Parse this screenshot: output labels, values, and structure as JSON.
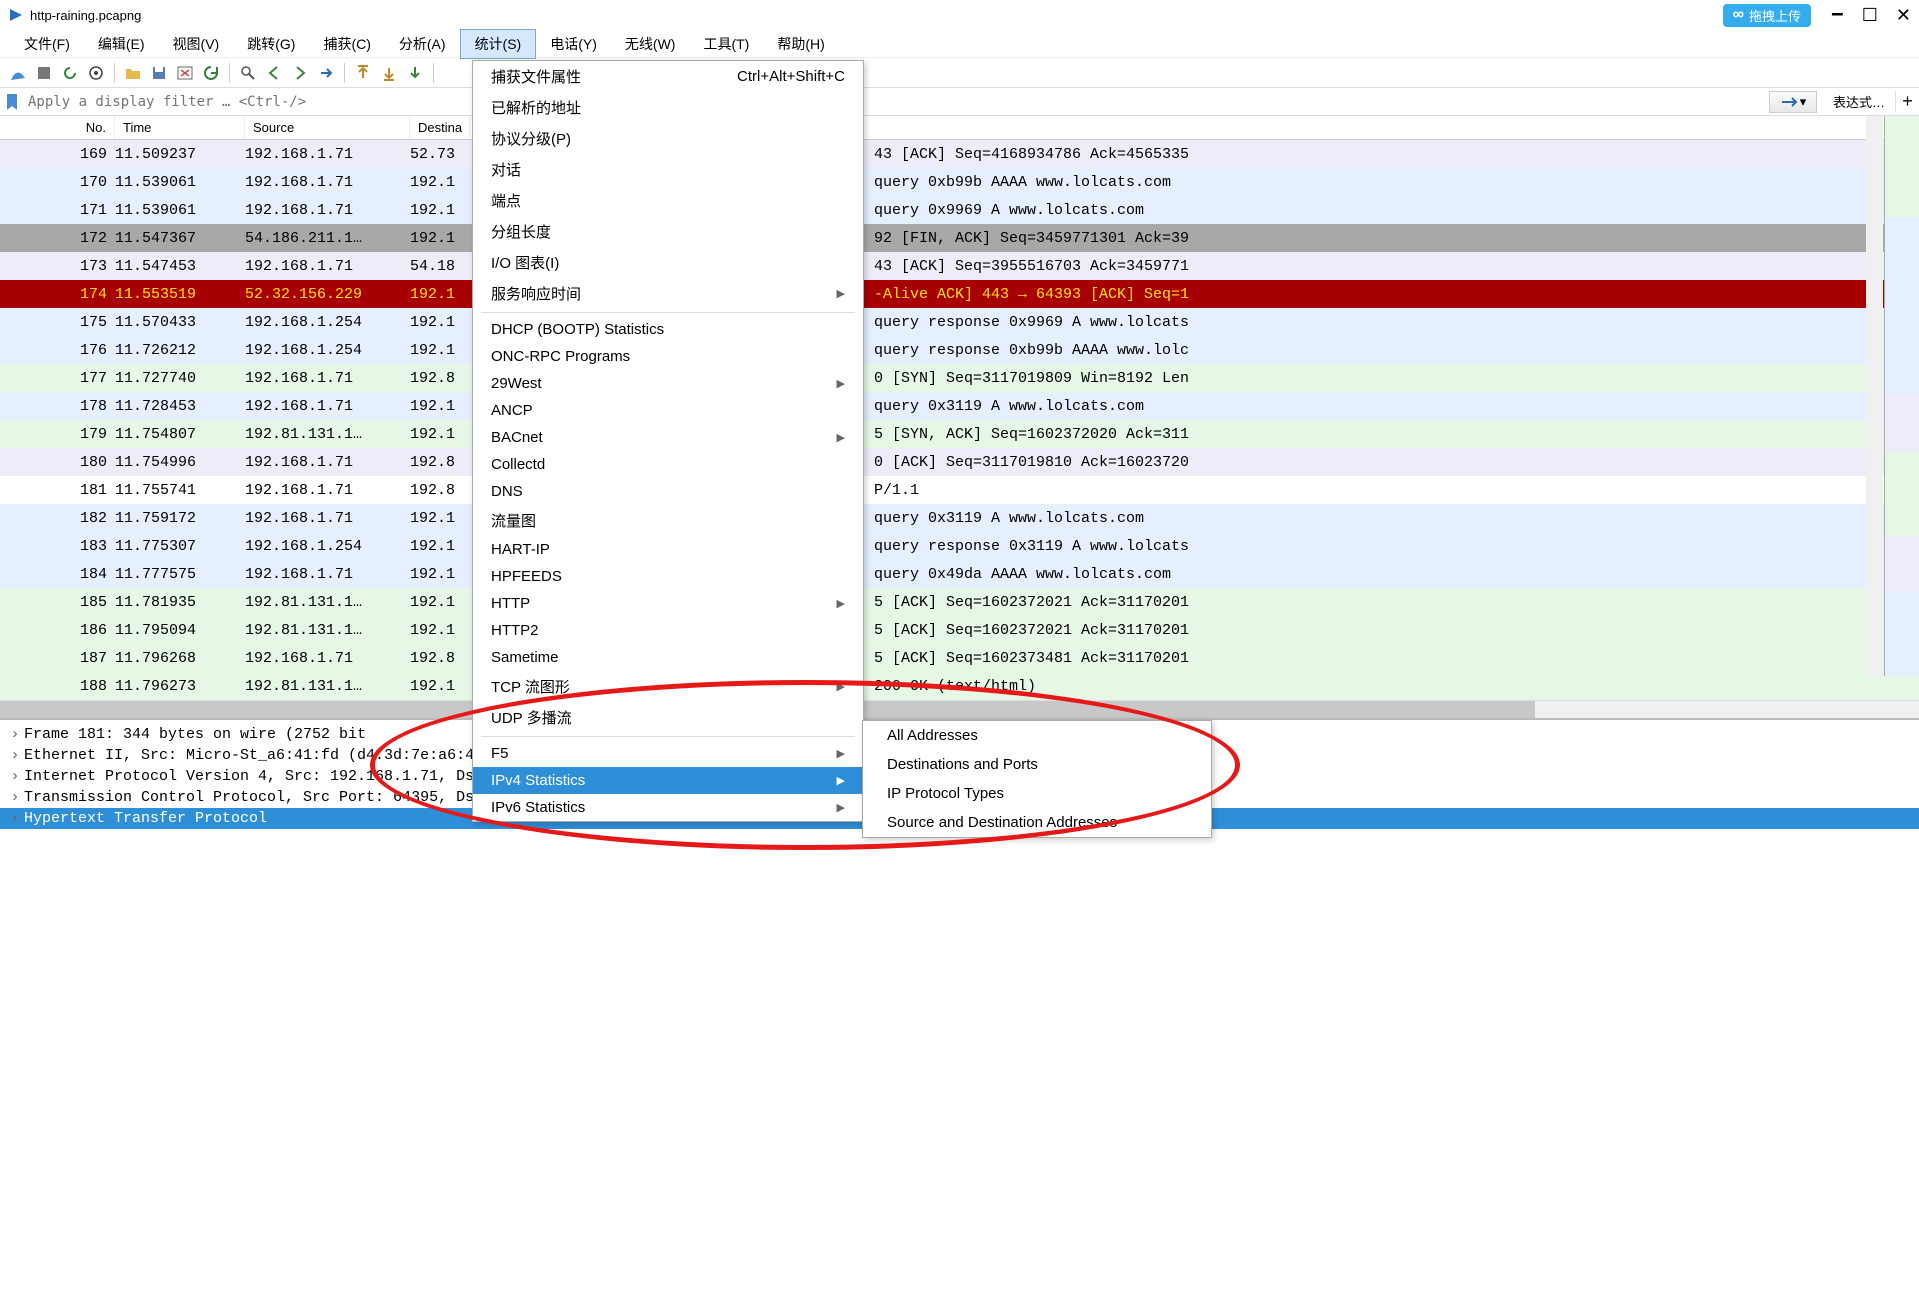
{
  "window": {
    "title": "http-raining.pcapng",
    "upload_btn": "拖拽上传",
    "minimize": "🗕",
    "maximize": "☐",
    "close": "✕"
  },
  "menus": [
    "文件(F)",
    "编辑(E)",
    "视图(V)",
    "跳转(G)",
    "捕获(C)",
    "分析(A)",
    "统计(S)",
    "电话(Y)",
    "无线(W)",
    "工具(T)",
    "帮助(H)"
  ],
  "active_menu_index": 6,
  "filter": {
    "placeholder": "Apply a display filter … <Ctrl-/>",
    "expr_label": "表达式…"
  },
  "columns": {
    "no": "No.",
    "time": "Time",
    "source": "Source",
    "dest": "Destina",
    "info_gap_left": "",
    "info_gap_right": ""
  },
  "rows": [
    {
      "no": "169",
      "time": "11.509237",
      "src": "192.168.1.71",
      "dst": "52.73",
      "info": "43 [ACK] Seq=4168934786 Ack=4565335",
      "cls": "purple"
    },
    {
      "no": "170",
      "time": "11.539061",
      "src": "192.168.1.71",
      "dst": "192.1",
      "info": "query 0xb99b AAAA www.lolcats.com",
      "cls": "bluelt"
    },
    {
      "no": "171",
      "time": "11.539061",
      "src": "192.168.1.71",
      "dst": "192.1",
      "info": "query 0x9969 A www.lolcats.com",
      "cls": "bluelt"
    },
    {
      "no": "172",
      "time": "11.547367",
      "src": "54.186.211.1…",
      "dst": "192.1",
      "info": "92 [FIN, ACK] Seq=3459771301 Ack=39",
      "cls": "gray"
    },
    {
      "no": "173",
      "time": "11.547453",
      "src": "192.168.1.71",
      "dst": "54.18",
      "info": "43 [ACK] Seq=3955516703 Ack=3459771",
      "cls": "purple"
    },
    {
      "no": "174",
      "time": "11.553519",
      "src": "52.32.156.229",
      "dst": "192.1",
      "info": "-Alive ACK] 443 → 64393 [ACK] Seq=1",
      "cls": "redbg"
    },
    {
      "no": "175",
      "time": "11.570433",
      "src": "192.168.1.254",
      "dst": "192.1",
      "info": "query response 0x9969 A www.lolcats",
      "cls": "bluelt"
    },
    {
      "no": "176",
      "time": "11.726212",
      "src": "192.168.1.254",
      "dst": "192.1",
      "info": "query response 0xb99b AAAA www.lolc",
      "cls": "bluelt"
    },
    {
      "no": "177",
      "time": "11.727740",
      "src": "192.168.1.71",
      "dst": "192.8",
      "info": "0 [SYN] Seq=3117019809 Win=8192 Len",
      "cls": "green"
    },
    {
      "no": "178",
      "time": "11.728453",
      "src": "192.168.1.71",
      "dst": "192.1",
      "info": "query 0x3119 A www.lolcats.com",
      "cls": "bluelt"
    },
    {
      "no": "179",
      "time": "11.754807",
      "src": "192.81.131.1…",
      "dst": "192.1",
      "info": "5 [SYN, ACK] Seq=1602372020 Ack=311",
      "cls": "green"
    },
    {
      "no": "180",
      "time": "11.754996",
      "src": "192.168.1.71",
      "dst": "192.8",
      "info": "0 [ACK] Seq=3117019810 Ack=16023720",
      "cls": "purple"
    },
    {
      "no": "181",
      "time": "11.755741",
      "src": "192.168.1.71",
      "dst": "192.8",
      "info": "P/1.1",
      "cls": "white"
    },
    {
      "no": "182",
      "time": "11.759172",
      "src": "192.168.1.71",
      "dst": "192.1",
      "info": "query 0x3119 A www.lolcats.com",
      "cls": "bluelt"
    },
    {
      "no": "183",
      "time": "11.775307",
      "src": "192.168.1.254",
      "dst": "192.1",
      "info": "query response 0x3119 A www.lolcats",
      "cls": "bluelt"
    },
    {
      "no": "184",
      "time": "11.777575",
      "src": "192.168.1.71",
      "dst": "192.1",
      "info": "query 0x49da AAAA www.lolcats.com",
      "cls": "bluelt"
    },
    {
      "no": "185",
      "time": "11.781935",
      "src": "192.81.131.1…",
      "dst": "192.1",
      "info": "5 [ACK] Seq=1602372021 Ack=31170201",
      "cls": "green"
    },
    {
      "no": "186",
      "time": "11.795094",
      "src": "192.81.131.1…",
      "dst": "192.1",
      "info": "5 [ACK] Seq=1602372021 Ack=31170201",
      "cls": "green"
    },
    {
      "no": "187",
      "time": "11.796268",
      "src": "192.168.1.71",
      "dst": "192.8",
      "info": "5 [ACK] Seq=1602373481 Ack=31170201",
      "cls": "green"
    },
    {
      "no": "188",
      "time": "11.796273",
      "src": "192.81.131.1…",
      "dst": "192.1",
      "info": "200 OK  (text/html)",
      "cls": "green"
    }
  ],
  "dropdown": {
    "items": [
      {
        "label": "捕获文件属性",
        "shortcut": "Ctrl+Alt+Shift+C"
      },
      {
        "label": "已解析的地址"
      },
      {
        "label": "协议分级(P)"
      },
      {
        "label": "对话"
      },
      {
        "label": "端点"
      },
      {
        "label": "分组长度"
      },
      {
        "label": "I/O 图表(I)"
      },
      {
        "label": "服务响应时间",
        "sub": true
      },
      {
        "sep": true
      },
      {
        "label": "DHCP (BOOTP) Statistics"
      },
      {
        "label": "ONC-RPC Programs"
      },
      {
        "label": "29West",
        "sub": true
      },
      {
        "label": "ANCP"
      },
      {
        "label": "BACnet",
        "sub": true
      },
      {
        "label": "Collectd"
      },
      {
        "label": "DNS"
      },
      {
        "label": "流量图"
      },
      {
        "label": "HART-IP"
      },
      {
        "label": "HPFEEDS"
      },
      {
        "label": "HTTP",
        "sub": true
      },
      {
        "label": "HTTP2"
      },
      {
        "label": "Sametime"
      },
      {
        "label": "TCP 流图形",
        "sub": true
      },
      {
        "label": "UDP 多播流"
      },
      {
        "sep": true
      },
      {
        "label": "F5",
        "sub": true
      },
      {
        "label": "IPv4 Statistics",
        "sub": true,
        "hl": true
      },
      {
        "label": "IPv6 Statistics",
        "sub": true
      }
    ]
  },
  "submenu": {
    "items": [
      "All Addresses",
      "Destinations and Ports",
      "IP Protocol Types",
      "Source and Destination Addresses"
    ]
  },
  "detail": {
    "lines": [
      "Frame 181: 344 bytes on wire (2752 bit",
      "Ethernet II, Src: Micro-St_a6:41:fd (d4:3d:7e:a6:41:fd), Dst: 2wire_ee:ea",
      "Internet Protocol Version 4, Src: 192.168.1.71, Dst: 192.81.131.161",
      "Transmission Control Protocol, Src Port: 64395, Dst Port: 80, Seq: 3117019810, Ack: 1602372021, Len: 290",
      "Hypertext Transfer Protocol"
    ],
    "selected_index": 4
  }
}
